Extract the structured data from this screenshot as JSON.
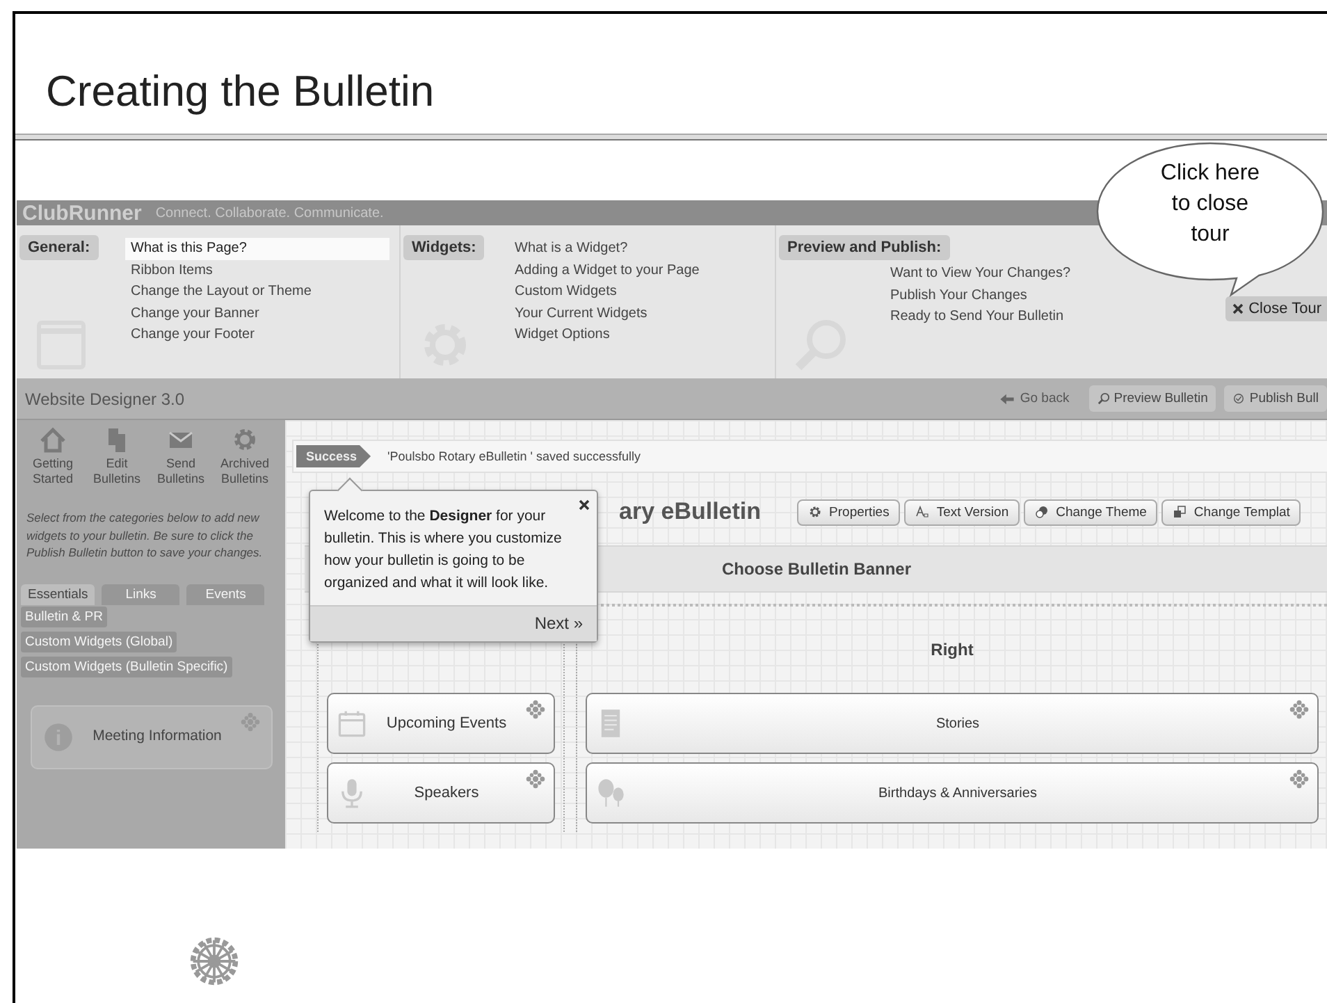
{
  "slide": {
    "title": "Creating the Bulletin"
  },
  "app_header": {
    "logo": "ClubRunner",
    "tagline": "Connect. Collaborate. Communicate."
  },
  "tour_ribbon": {
    "groups": [
      {
        "label": "General:",
        "kind": "window",
        "items": [
          {
            "label": "What is this Page?",
            "selected": true
          },
          {
            "label": "Ribbon Items",
            "selected": false
          },
          {
            "label": "Change the Layout or Theme",
            "selected": false
          },
          {
            "label": "Change your Banner",
            "selected": false
          },
          {
            "label": "Change your Footer",
            "selected": false
          }
        ]
      },
      {
        "label": "Widgets:",
        "kind": "gear",
        "items": [
          {
            "label": "What is a Widget?",
            "selected": false
          },
          {
            "label": "Adding a Widget to your Page",
            "selected": false
          },
          {
            "label": "Custom Widgets",
            "selected": false
          },
          {
            "label": "Your Current Widgets",
            "selected": false
          },
          {
            "label": "Widget Options",
            "selected": false
          }
        ]
      },
      {
        "label": "Preview and Publish:",
        "kind": "magnifier",
        "items": [
          {
            "label": "Want to View Your Changes?",
            "selected": false
          },
          {
            "label": "Publish Your Changes",
            "selected": false
          },
          {
            "label": "Ready to Send Your Bulletin",
            "selected": false
          }
        ]
      }
    ],
    "close_button": "Close Tour"
  },
  "callout": {
    "text": "Click here to close tour"
  },
  "designer_toolbar": {
    "title": "Website Designer 3.0",
    "back": "Go back",
    "buttons": [
      {
        "label": "Preview Bulletin",
        "kind": "magnifier"
      },
      {
        "label": "Publish Bull",
        "kind": "check"
      }
    ]
  },
  "sidebar": {
    "nav": [
      {
        "label": "Getting Started",
        "kind": "home"
      },
      {
        "label": "Edit Bulletins",
        "kind": "documents"
      },
      {
        "label": "Send Bulletins",
        "kind": "envelope"
      },
      {
        "label": "Archived Bulletins",
        "kind": "gear"
      }
    ],
    "help": "Select from the categories below to add new widgets to your bulletin. Be sure to click the Publish Bulletin button to save your changes.",
    "tabs": [
      {
        "label": "Essentials",
        "selected": true
      },
      {
        "label": "Links",
        "selected": false
      },
      {
        "label": "Events",
        "selected": false
      }
    ],
    "categories": [
      "Bulletin & PR",
      "Custom Widgets (Global)",
      "Custom Widgets (Bulletin Specific)"
    ],
    "widgets": [
      {
        "label": "Meeting Information",
        "kind": "info"
      }
    ]
  },
  "canvas": {
    "status": {
      "badge": "Success",
      "message": "'Poulsbo Rotary eBulletin ' saved successfully"
    },
    "title": "ary eBulletin",
    "buttons": [
      {
        "label": "Properties",
        "kind": "gear"
      },
      {
        "label": "Text Version",
        "kind": "text"
      },
      {
        "label": "Change Theme",
        "kind": "theme"
      },
      {
        "label": "Change Templat",
        "kind": "template"
      }
    ],
    "banner": "Choose Bulletin Banner",
    "columns": [
      {
        "widgets": [
          {
            "label": "Upcoming Events",
            "kind": "calendar"
          },
          {
            "label": "Speakers",
            "kind": "microphone"
          }
        ]
      },
      {
        "heading": "Right",
        "widgets": [
          {
            "label": "Stories",
            "kind": "document"
          },
          {
            "label": "Birthdays & Anniversaries",
            "kind": "balloons"
          }
        ]
      }
    ]
  },
  "tour_popup": {
    "text": "Welcome to the **Designer** for your bulletin. This is where you customize how your bulletin is going to be organized and what it will look like.",
    "next": "Next »"
  }
}
